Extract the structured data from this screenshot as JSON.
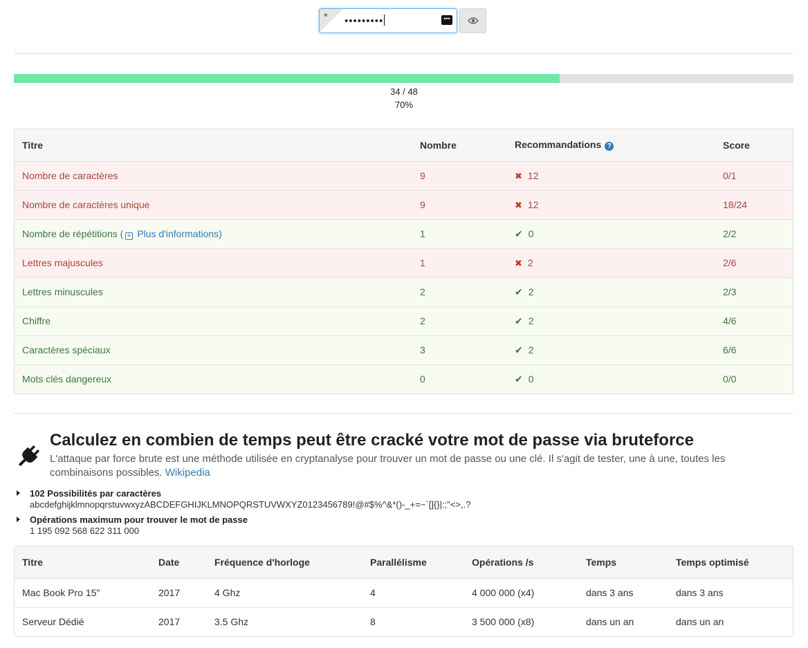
{
  "password": {
    "masked_value": "•••••••••",
    "prefix_symbol": "*",
    "toggle_icon": "eye-icon"
  },
  "progress": {
    "fraction": 0.7,
    "count_text": "34 / 48",
    "percent_text": "70%",
    "bar_color": "#6ee8a8"
  },
  "criteria_table": {
    "headers": [
      "Titre",
      "Nombre",
      "Recommandations",
      "Score"
    ],
    "more_info_label": "Plus d'informations",
    "rows": [
      {
        "title": "Nombre de caractères",
        "count": "9",
        "status": "bad",
        "recommendation": "12",
        "score": "0/1"
      },
      {
        "title": "Nombre de caractères unique",
        "count": "9",
        "status": "bad",
        "recommendation": "12",
        "score": "18/24"
      },
      {
        "title": "Nombre de répétitions",
        "count": "1",
        "status": "good",
        "recommendation": "0",
        "score": "2/2"
      },
      {
        "title": "Lettres majuscules",
        "count": "1",
        "status": "bad",
        "recommendation": "2",
        "score": "2/6"
      },
      {
        "title": "Lettres minuscules",
        "count": "2",
        "status": "good",
        "recommendation": "2",
        "score": "2/3"
      },
      {
        "title": "Chiffre",
        "count": "2",
        "status": "good",
        "recommendation": "2",
        "score": "4/6"
      },
      {
        "title": "Caractères spéciaux",
        "count": "3",
        "status": "good",
        "recommendation": "2",
        "score": "6/6"
      },
      {
        "title": "Mots clés dangereux",
        "count": "0",
        "status": "good",
        "recommendation": "0",
        "score": "0/0"
      }
    ]
  },
  "bruteforce": {
    "icon": "plug-icon",
    "title": "Calculez en combien de temps peut être cracké votre mot de passe via bruteforce",
    "description": "L'attaque par force brute est une méthode utilisée en cryptanalyse pour trouver un mot de passe ou une clé. Il s'agit de tester, une à une, toutes les combinaisons possibles.",
    "link_label": "Wikipedia",
    "possibilities_label": "102 Possibilités par caractères",
    "charset": "abcdefghijklmnopqrstuvwxyzABCDEFGHIJKLMNOPQRSTUVWXYZ0123456789!@#$%^&*()-_+=~`[]{}|:;\"<>,.?",
    "max_ops_label": "Opérations maximum pour trouver le mot de passe",
    "max_ops_value": "1 195 092 568 622 311 000"
  },
  "machines_table": {
    "headers": [
      "Titre",
      "Date",
      "Fréquence d'horloge",
      "Parallélisme",
      "Opérations /s",
      "Temps",
      "Temps optimisé"
    ],
    "rows": [
      {
        "title": "Mac Book Pro 15\"",
        "date": "2017",
        "clock": "4 Ghz",
        "parallel": "4",
        "ops": "4 000 000 (x4)",
        "time": "dans 3 ans",
        "time_opt": "dans 3 ans"
      },
      {
        "title": "Serveur Dédié",
        "date": "2017",
        "clock": "3.5 Ghz",
        "parallel": "8",
        "ops": "3 500 000 (x8)",
        "time": "dans un an",
        "time_opt": "dans un an"
      }
    ]
  }
}
